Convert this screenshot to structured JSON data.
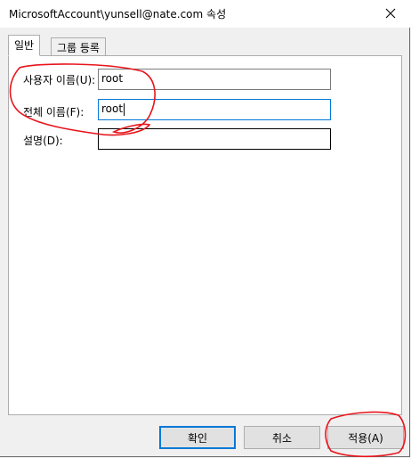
{
  "window": {
    "title": "MicrosoftAccount\\yunsell@nate.com 속성"
  },
  "tabs": [
    {
      "label": "일반",
      "active": true
    },
    {
      "label": "그룹 등록",
      "active": false
    }
  ],
  "form": {
    "username": {
      "label": "사용자 이름(U):",
      "value": "root"
    },
    "fullname": {
      "label": "전체 이름(F):",
      "value": "root"
    },
    "description": {
      "label": "설명(D):",
      "value": ""
    }
  },
  "buttons": {
    "ok": "확인",
    "cancel": "취소",
    "apply": "적용(A)"
  },
  "colors": {
    "accent": "#0078d7",
    "annotation": "#e8141c"
  },
  "icons": {
    "close": "close-icon"
  }
}
